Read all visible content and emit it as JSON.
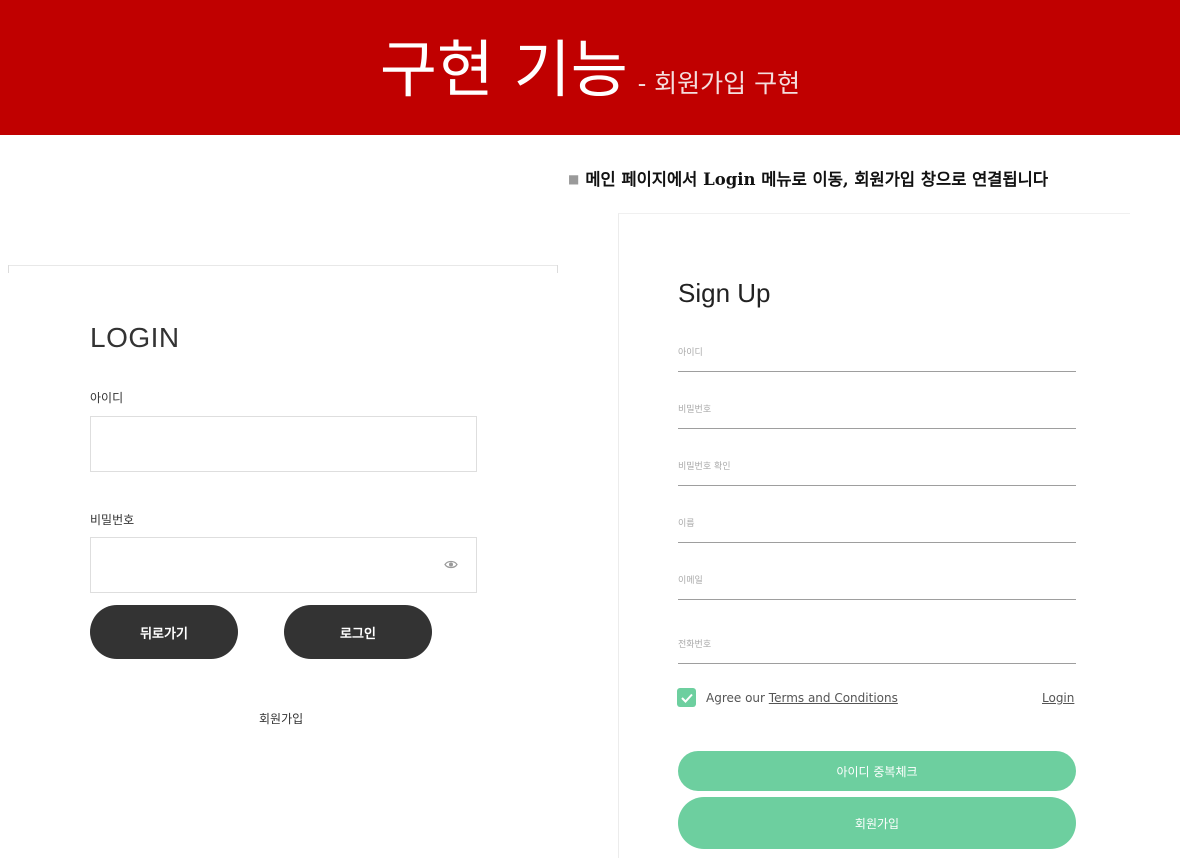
{
  "banner": {
    "title": "구현 기능",
    "subtitle": "- 회원가입 구현"
  },
  "bullet": {
    "text": "메인 페이지에서 Login 메뉴로 이동, 회원가입 창으로 연결됩니다"
  },
  "login": {
    "title": "LOGIN",
    "id_label": "아이디",
    "password_label": "비밀번호",
    "back_button": "뒤로가기",
    "login_button": "로그인",
    "signup_link": "회원가입"
  },
  "signup": {
    "title": "Sign Up",
    "fields": [
      "아이디",
      "비밀번호",
      "비밀번호 확인",
      "이름",
      "이메일",
      "전화번호"
    ],
    "agree_prefix": "Agree our",
    "terms": "Terms and Conditions",
    "login_link": "Login",
    "dup_check_button": "아이디 중복체크",
    "signup_button": "회원가입"
  },
  "colors": {
    "banner": "#c00000",
    "accent_green": "#6dcf9f",
    "dark_button": "#333333"
  },
  "icons": {
    "password_visibility": "eye-icon",
    "agree_checkbox": "check-icon"
  }
}
